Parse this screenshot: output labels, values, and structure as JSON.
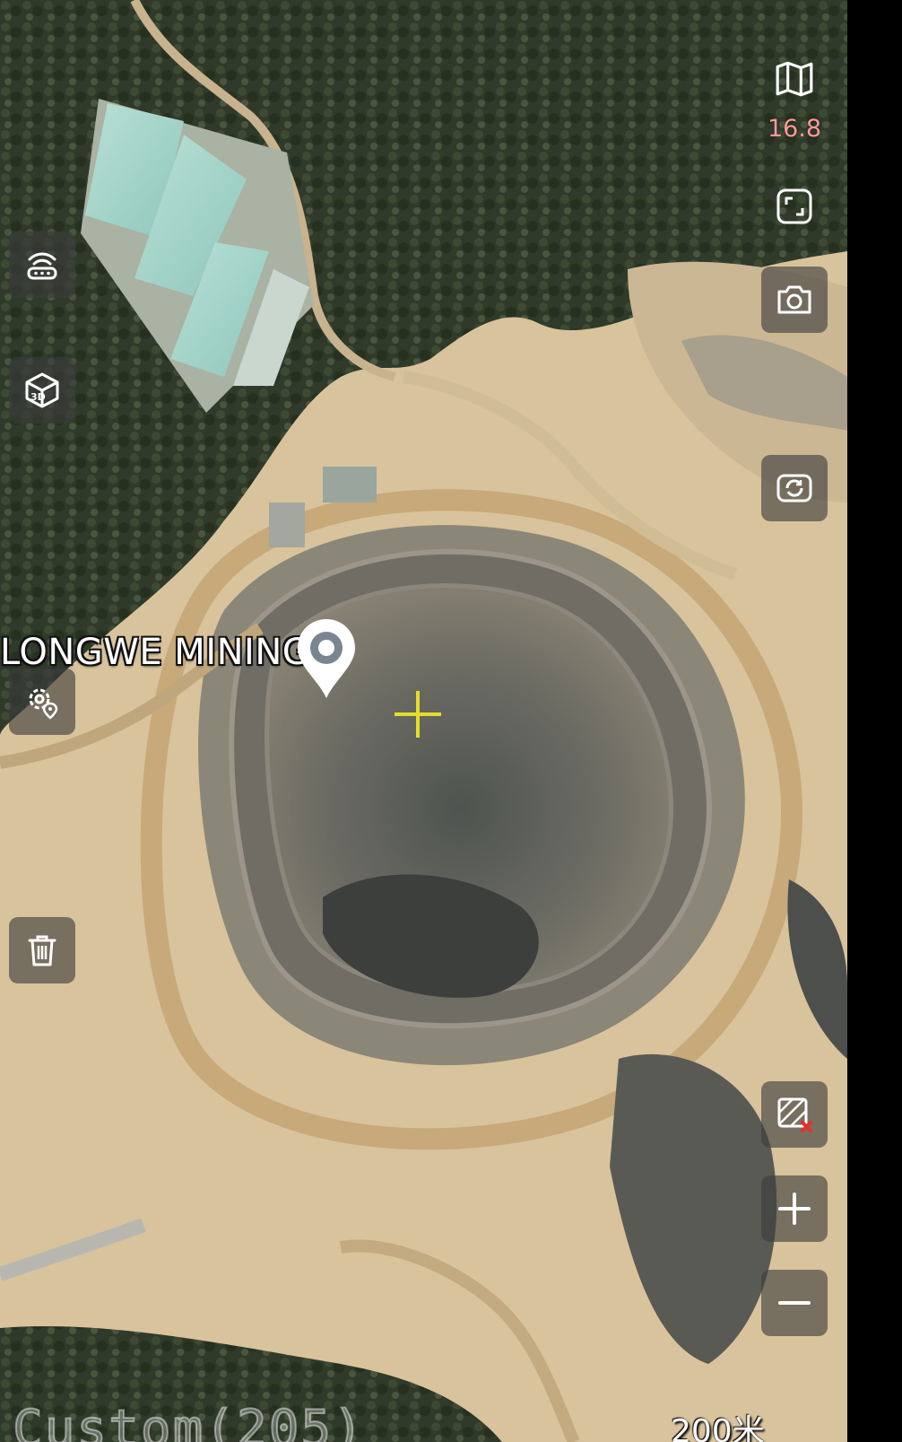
{
  "map": {
    "place_label": "LONGWE MINING",
    "zoom_level": "16.8",
    "scale_label": "200米",
    "layer_name": "Custom(205)"
  },
  "controls": {
    "left": [
      "wifi-signal-icon",
      "3d-view-icon",
      "location-settings-icon",
      "delete-icon"
    ],
    "right": [
      "map-layers-icon",
      "fullscreen-icon",
      "camera-icon",
      "rotate-camera-icon",
      "clear-overlay-icon",
      "zoom-in-icon",
      "zoom-out-icon"
    ],
    "text_3d": "3D"
  },
  "colors": {
    "zoom_text": "#ff9a9a",
    "crosshair": "#e4de2a",
    "control_bg": "rgba(60,60,60,0.62)",
    "clear_marker": "#e0322b"
  }
}
